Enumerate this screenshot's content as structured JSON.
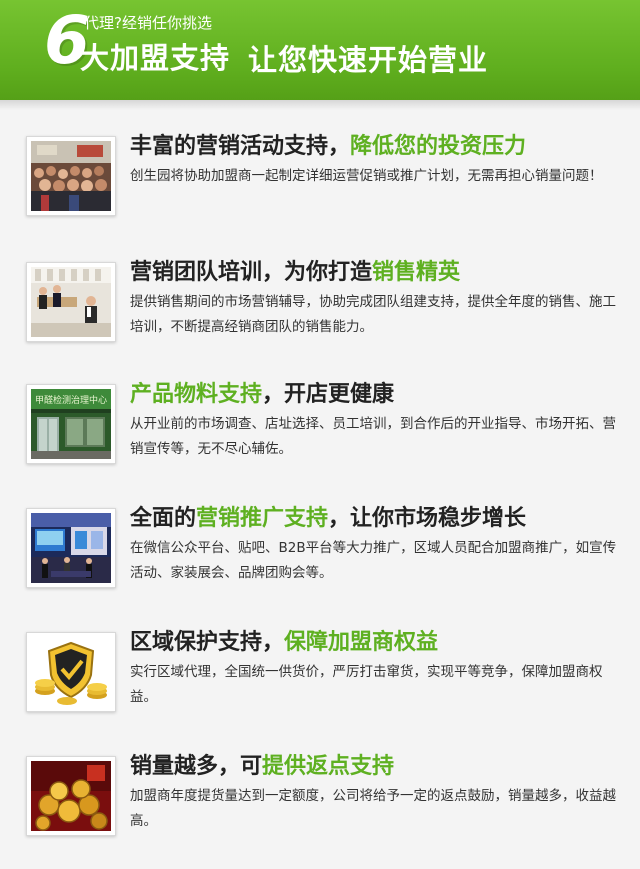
{
  "header": {
    "number": "6",
    "small_text": "代理?经销任你挑选",
    "main_text": "大加盟支持",
    "tagline": "让您快速开始营业"
  },
  "items": [
    {
      "title_pre": "丰富的营销活动支持，",
      "title_hl": "降低您的投资压力",
      "title_post": "",
      "desc": "创生园将协助加盟商一起制定详细运营促销或推广计划，无需再担心销量问题！",
      "image_icon": "crowd-event-photo"
    },
    {
      "title_pre": "营销团队培训，为你打造",
      "title_hl": "销售精英",
      "title_post": "",
      "desc": "提供销售期间的市场营销辅导，协助完成团队组建支持，提供全年度的销售、施工培训，不断提高经销商团队的销售能力。",
      "image_icon": "training-room-photo"
    },
    {
      "title_pre": "",
      "title_hl": "产品物料支持",
      "title_post": "，开店更健康",
      "desc": "从开业前的市场调查、店址选择、员工培训，到合作后的开业指导、市场开拓、营销宣传等，无不尽心辅佐。",
      "image_icon": "storefront-photo",
      "sign_text": "甲醛检测治理中心"
    },
    {
      "title_pre": "全面的",
      "title_hl": "营销推广支持",
      "title_post": "，让你市场稳步增长",
      "desc": "在微信公众平台、贴吧、B2B平台等大力推广，区域人员配合加盟商推广，如宣传活动、家装展会、品牌团购会等。",
      "image_icon": "exhibition-booth-photo"
    },
    {
      "title_pre": "区域保护支持，",
      "title_hl": "保障加盟商权益",
      "title_post": "",
      "desc": "实行区域代理，全国统一供货价，严厉打击窜货，实现平等竞争，保障加盟商权益。",
      "image_icon": "shield-coins-icon"
    },
    {
      "title_pre": "销量越多，可",
      "title_hl": "提供返点支持",
      "title_post": "",
      "desc": "加盟商年度提货量达到一定额度，公司将给予一定的返点鼓励，销量越多，收益越高。",
      "image_icon": "gold-coins-photo"
    }
  ],
  "colors": {
    "header_green": "#5fae1e",
    "highlight_green": "#5eb021",
    "title_text": "#222222"
  }
}
